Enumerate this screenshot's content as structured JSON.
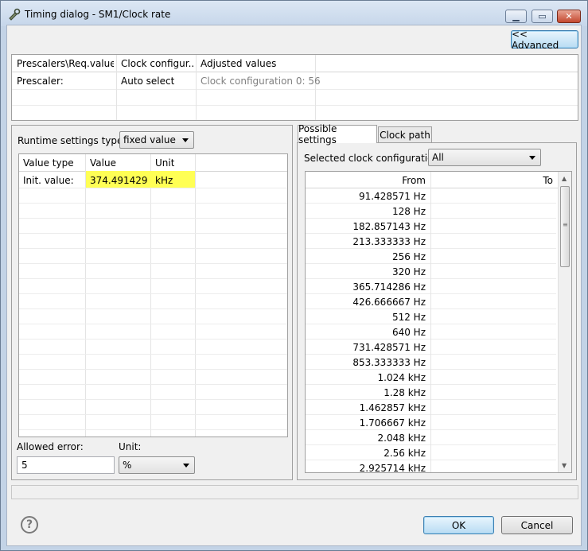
{
  "window": {
    "title": "Timing dialog - SM1/Clock rate",
    "icons": {
      "app": "wrench-icon",
      "minimize": "minimize-icon",
      "maximize": "maximize-icon",
      "close": "close-icon"
    }
  },
  "advanced_button": "<< Advanced",
  "top_table": {
    "headers": [
      "Prescalers\\Req.value",
      "Clock configur...",
      "Adjusted values"
    ],
    "row": {
      "col1": "Prescaler:",
      "col2": "Auto select",
      "col3": "Clock configuration 0: 56"
    }
  },
  "left": {
    "runtime_label": "Runtime settings type:",
    "runtime_value": "fixed value",
    "table_headers": [
      "Value type",
      "Value",
      "Unit"
    ],
    "row": {
      "type": "Init. value:",
      "value": "374.491429",
      "unit": "kHz"
    },
    "allowed_error_label": "Allowed error:",
    "allowed_error_value": "5",
    "unit_label": "Unit:",
    "unit_value": "%",
    "highlight_color": "#ffff55"
  },
  "right": {
    "tabs": [
      "Possible settings",
      "Clock path"
    ],
    "selected_config_label": "Selected clock configuration",
    "selected_config_value": "All",
    "headers": [
      "From",
      "To"
    ],
    "rows": [
      "91.428571 Hz",
      "128 Hz",
      "182.857143 Hz",
      "213.333333 Hz",
      "256 Hz",
      "320 Hz",
      "365.714286 Hz",
      "426.666667 Hz",
      "512 Hz",
      "640 Hz",
      "731.428571 Hz",
      "853.333333 Hz",
      "1.024 kHz",
      "1.28 kHz",
      "1.462857 kHz",
      "1.706667 kHz",
      "2.048 kHz",
      "2.56 kHz",
      "2.925714 kHz"
    ]
  },
  "ok_button": "OK",
  "cancel_button": "Cancel",
  "help_icon": "help-icon",
  "help_glyph": "?"
}
